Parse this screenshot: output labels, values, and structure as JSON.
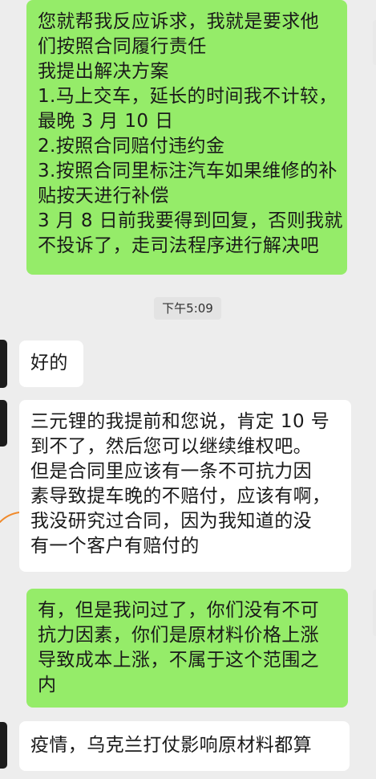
{
  "messages": [
    {
      "side": "me",
      "lines": [
        "您就帮我反应诉求，我就是要求他",
        "们按照合同履行责任",
        "我提出解决方案",
        "1.马上交车，延长的时间我不计较，",
        "最晚 3 月 10 日",
        "2.按照合同赔付违约金",
        "3.按照合同里标注汽车如果维修的补",
        "贴按天进行补偿",
        "3 月 8 日前我要得到回复，否则我就",
        "不投诉了，走司法程序进行解决吧"
      ]
    },
    {
      "side": "them",
      "lines": [
        "好的"
      ]
    },
    {
      "side": "them",
      "lines": [
        "三元锂的我提前和您说，肯定 10 号",
        "到不了，然后您可以继续维权吧。",
        "但是合同里应该有一条不可抗力因",
        "素导致提车晚的不赔付，应该有啊，",
        "我没研究过合同，因为我知道的没",
        "有一个客户有赔付的"
      ]
    },
    {
      "side": "me",
      "lines": [
        "有，但是我问过了，你们没有不可",
        "抗力因素，你们是原材料价格上涨",
        "导致成本上涨，不属于这个范围之",
        "内"
      ]
    },
    {
      "side": "them",
      "lines": [
        "疫情，乌克兰打仗影响原材料都算"
      ]
    }
  ],
  "timestamp": "下午5:09",
  "colors": {
    "background": "#ededed",
    "me_bubble": "#95ec69",
    "them_bubble": "#ffffff",
    "timestamp_bg": "#e3e3e3"
  }
}
